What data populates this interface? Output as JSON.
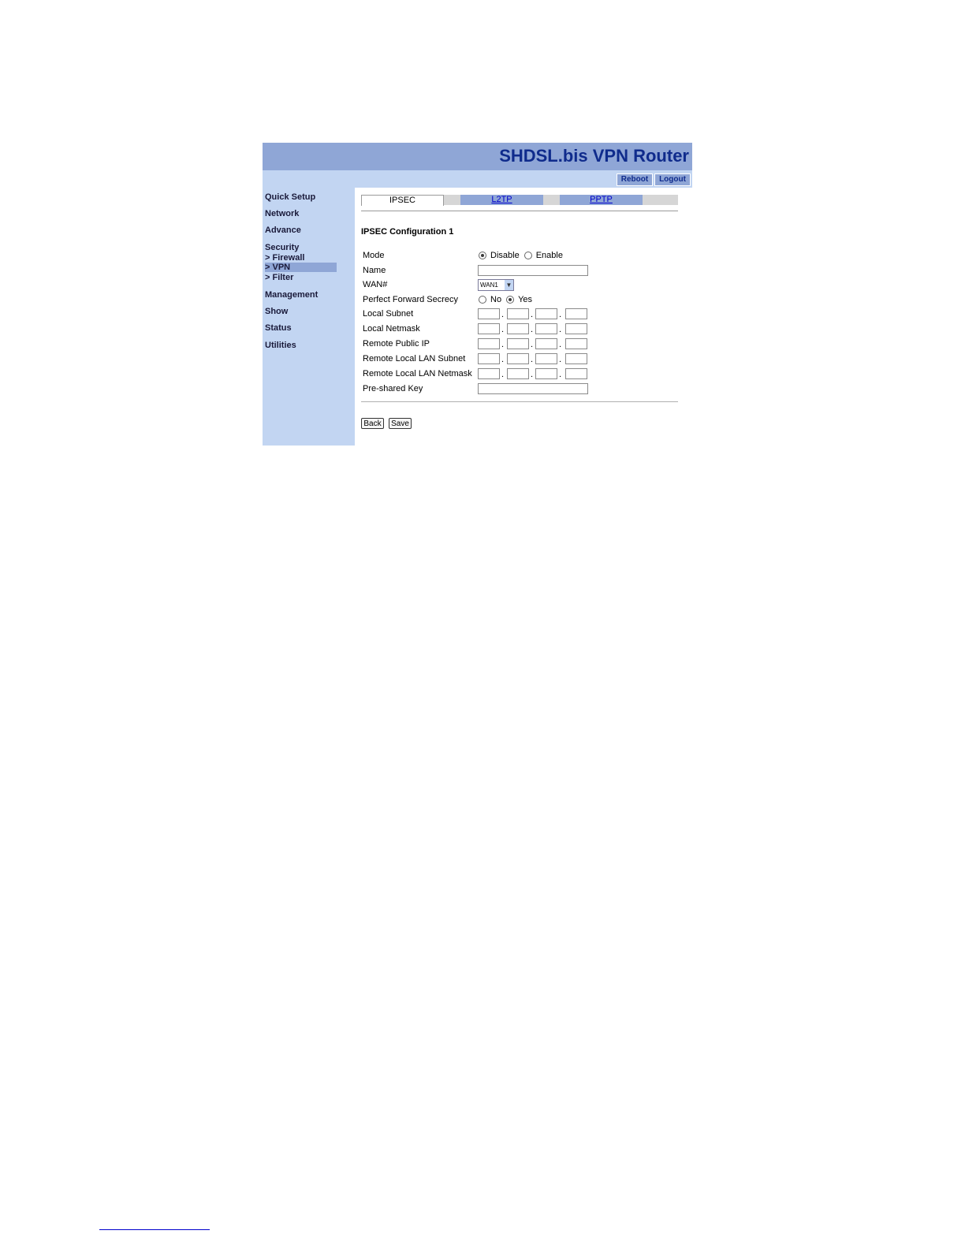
{
  "app": {
    "title": "SHDSL.bis VPN Router",
    "header_buttons": {
      "reboot": "Reboot",
      "logout": "Logout"
    }
  },
  "sidebar": {
    "items": [
      {
        "label": "Quick Setup"
      },
      {
        "label": "Network"
      },
      {
        "label": "Advance"
      },
      {
        "label": "Security"
      },
      {
        "label": "> Firewall"
      },
      {
        "label": "> VPN",
        "active": true
      },
      {
        "label": "> Filter"
      },
      {
        "label": "Management"
      },
      {
        "label": "Show"
      },
      {
        "label": "Status"
      },
      {
        "label": "Utilities"
      }
    ]
  },
  "tabs": [
    {
      "label": "IPSEC",
      "active": true
    },
    {
      "label": "L2TP"
    },
    {
      "label": "PPTP"
    }
  ],
  "form": {
    "title": "IPSEC Configuration 1",
    "mode": {
      "label": "Mode",
      "options": [
        "Disable",
        "Enable"
      ],
      "selected": "Disable"
    },
    "name": {
      "label": "Name",
      "value": ""
    },
    "wan": {
      "label": "WAN#",
      "value": "WAN1"
    },
    "pfs": {
      "label": "Perfect Forward Secrecy",
      "options": [
        "No",
        "Yes"
      ],
      "selected": "Yes"
    },
    "local_subnet": {
      "label": "Local Subnet"
    },
    "local_netmask": {
      "label": "Local Netmask"
    },
    "remote_public_ip": {
      "label": "Remote Public IP"
    },
    "remote_lan_subnet": {
      "label": "Remote Local LAN Subnet"
    },
    "remote_lan_netmask": {
      "label": "Remote Local LAN Netmask"
    },
    "psk": {
      "label": "Pre-shared Key",
      "value": ""
    },
    "ip_separator": "."
  },
  "actions": {
    "back": "Back",
    "save": "Save"
  },
  "colors": {
    "header": "#8fa6d6",
    "sidebar": "#c2d5f2",
    "title_text": "#0f2b8c",
    "tab_link": "#0000cc"
  }
}
